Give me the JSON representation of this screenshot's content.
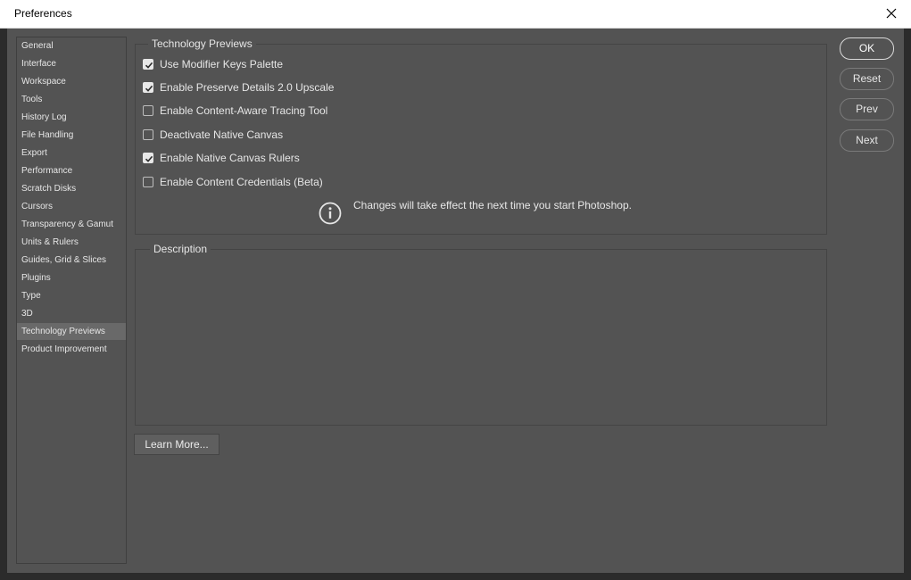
{
  "window": {
    "title": "Preferences",
    "close_icon": "close-icon"
  },
  "sidebar": {
    "selected_index": 16,
    "items": [
      {
        "label": "General"
      },
      {
        "label": "Interface"
      },
      {
        "label": "Workspace"
      },
      {
        "label": "Tools"
      },
      {
        "label": "History Log"
      },
      {
        "label": "File Handling"
      },
      {
        "label": "Export"
      },
      {
        "label": "Performance"
      },
      {
        "label": "Scratch Disks"
      },
      {
        "label": "Cursors"
      },
      {
        "label": "Transparency & Gamut"
      },
      {
        "label": "Units & Rulers"
      },
      {
        "label": "Guides, Grid & Slices"
      },
      {
        "label": "Plugins"
      },
      {
        "label": "Type"
      },
      {
        "label": "3D"
      },
      {
        "label": "Technology Previews"
      },
      {
        "label": "Product Improvement"
      }
    ]
  },
  "tech_previews": {
    "legend": "Technology Previews",
    "options": [
      {
        "label": "Use Modifier Keys Palette",
        "checked": true
      },
      {
        "label": "Enable Preserve Details 2.0 Upscale",
        "checked": true
      },
      {
        "label": "Enable Content-Aware Tracing Tool",
        "checked": false
      },
      {
        "label": "Deactivate Native Canvas",
        "checked": false
      },
      {
        "label": "Enable Native Canvas Rulers",
        "checked": true
      },
      {
        "label": "Enable Content Credentials (Beta)",
        "checked": false
      }
    ],
    "notice": {
      "icon": "info-icon",
      "text": "Changes will take effect the next time you start Photoshop."
    }
  },
  "description": {
    "legend": "Description",
    "text": ""
  },
  "buttons": {
    "ok": "OK",
    "reset": "Reset",
    "prev": "Prev",
    "next": "Next",
    "learn_more": "Learn More..."
  },
  "colors": {
    "panel": "#535353",
    "selected_item": "#696969",
    "text": "#e6e6e6"
  }
}
